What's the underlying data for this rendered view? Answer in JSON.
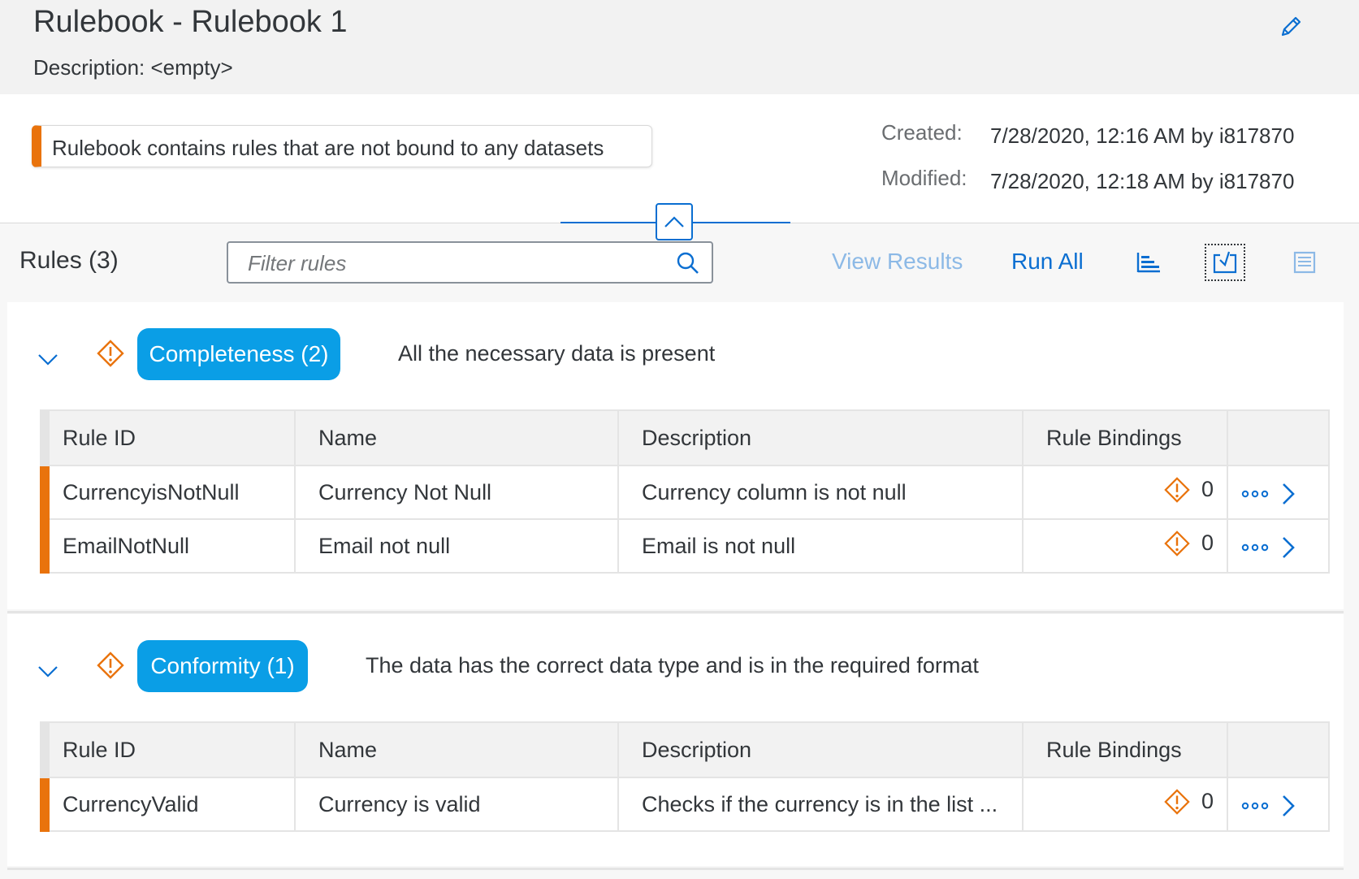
{
  "header": {
    "title": "Rulebook - Rulebook 1",
    "description": "Description: <empty>"
  },
  "info": {
    "warning": "Rulebook contains rules that are not bound to any datasets",
    "created_label": "Created:",
    "created_value": "7/28/2020, 12:16 AM by i817870",
    "modified_label": "Modified:",
    "modified_value": "7/28/2020, 12:18 AM by i817870"
  },
  "toolbar": {
    "title": "Rules (3)",
    "filter_placeholder": "Filter rules",
    "view_results": "View Results",
    "run_all": "Run All"
  },
  "columns": [
    "Rule ID",
    "Name",
    "Description",
    "Rule Bindings"
  ],
  "categories": [
    {
      "label": "Completeness (2)",
      "description": "All the necessary data is present",
      "rows": [
        {
          "id": "CurrencyisNotNull",
          "name": "Currency Not Null",
          "description": "Currency column is not null",
          "bindings": "0"
        },
        {
          "id": "EmailNotNull",
          "name": "Email not null",
          "description": "Email is not null",
          "bindings": "0"
        }
      ]
    },
    {
      "label": "Conformity (1)",
      "description": "The data has the correct data type and is in the required format",
      "rows": [
        {
          "id": "CurrencyValid",
          "name": "Currency is valid",
          "description": "Checks if the currency is in the list ...",
          "bindings": "0"
        }
      ]
    }
  ],
  "colors": {
    "accent": "#0a6ed1",
    "warning": "#e9730c",
    "pill": "#0a9ee6"
  }
}
